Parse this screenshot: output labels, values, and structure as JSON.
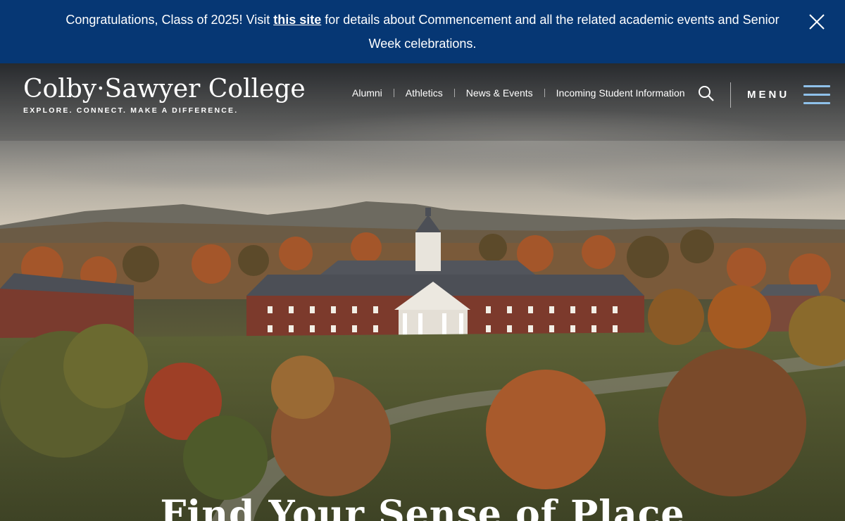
{
  "banner": {
    "text_before": "Congratulations, Class of 2025! Visit ",
    "link_text": "this site",
    "text_after": " for details about Commencement and all the related academic events and Senior Week celebrations.",
    "background": "#063774",
    "close_icon": "close-icon"
  },
  "header": {
    "logo_name": "Colby·Sawyer College",
    "logo_tagline": "EXPLORE. CONNECT. MAKE A DIFFERENCE.",
    "nav": [
      {
        "label": "Alumni"
      },
      {
        "label": "Athletics"
      },
      {
        "label": "News & Events"
      },
      {
        "label": "Incoming Student Information"
      }
    ],
    "search_icon": "search-icon",
    "menu_label": "MENU",
    "menu_icon": "hamburger-icon",
    "accent": "#8fc1ea"
  },
  "hero": {
    "title": "Find Your Sense of Place"
  }
}
